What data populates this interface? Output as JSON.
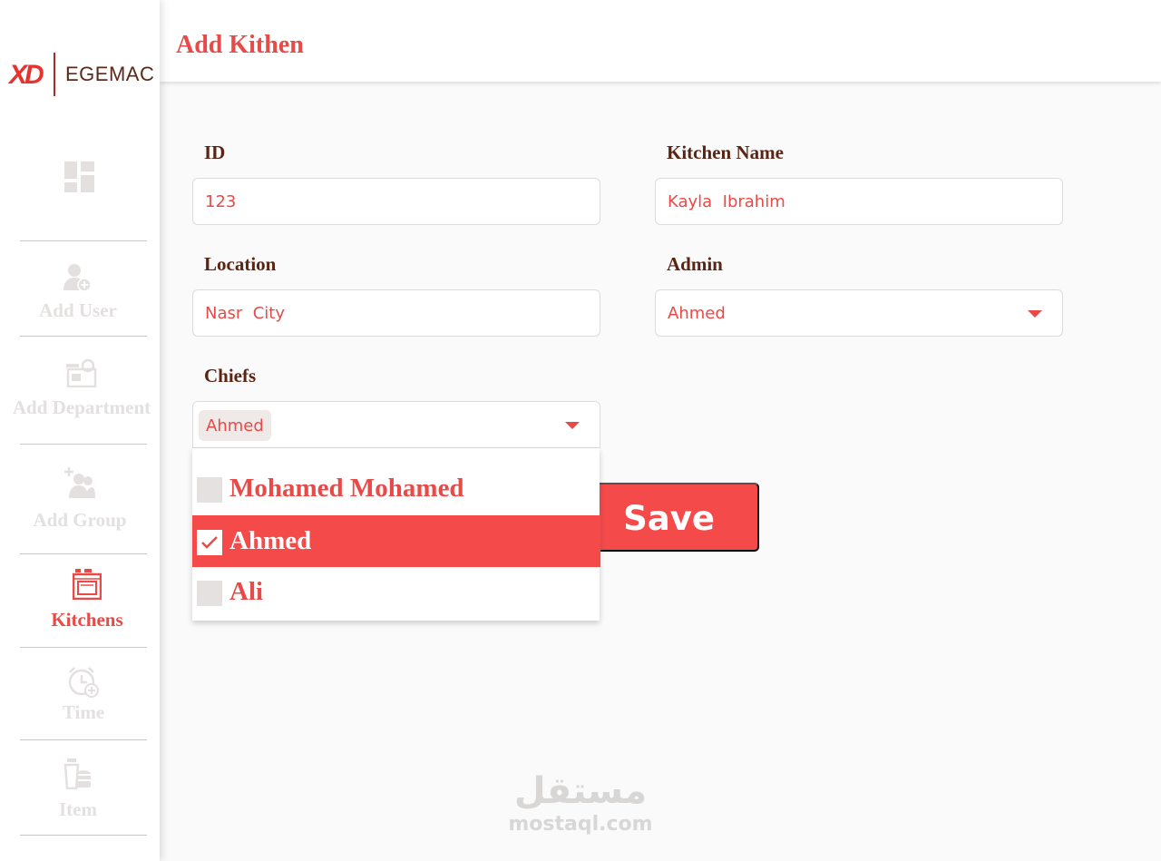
{
  "brand": {
    "mark": "XD",
    "name": "EGEMAC"
  },
  "sidebar": {
    "items": [
      {
        "label": "",
        "icon": "dashboard-icon",
        "active": false
      },
      {
        "label": "Add User",
        "icon": "add-user-icon",
        "active": false
      },
      {
        "label": "Add Department",
        "icon": "department-icon",
        "active": false
      },
      {
        "label": "Add Group",
        "icon": "add-group-icon",
        "active": false
      },
      {
        "label": "Kitchens",
        "icon": "kitchen-stove-icon",
        "active": true
      },
      {
        "label": "Time",
        "icon": "alarm-clock-icon",
        "active": false
      },
      {
        "label": "Item",
        "icon": "food-item-icon",
        "active": false
      }
    ]
  },
  "header": {
    "title": "Add Kithen"
  },
  "form": {
    "id": {
      "label": "ID",
      "value": "123"
    },
    "kitchen_name": {
      "label": "Kitchen Name",
      "value": "Kayla  Ibrahim"
    },
    "location": {
      "label": "Location",
      "value": "Nasr  City"
    },
    "admin": {
      "label": "Admin",
      "value": "Ahmed"
    },
    "chiefs": {
      "label": "Chiefs",
      "selected_chip": "Ahmed",
      "options": [
        {
          "label": "Mohamed Mohamed",
          "checked": false
        },
        {
          "label": "Ahmed",
          "checked": true
        },
        {
          "label": "Ali",
          "checked": false
        }
      ]
    },
    "save_label": "Save"
  },
  "watermark": {
    "arabic": "مستقل",
    "latin": "mostaql.com"
  },
  "colors": {
    "accent": "#e84a47",
    "button": "#f44a4a",
    "label": "#5c2412",
    "muted": "#e3e0df"
  }
}
